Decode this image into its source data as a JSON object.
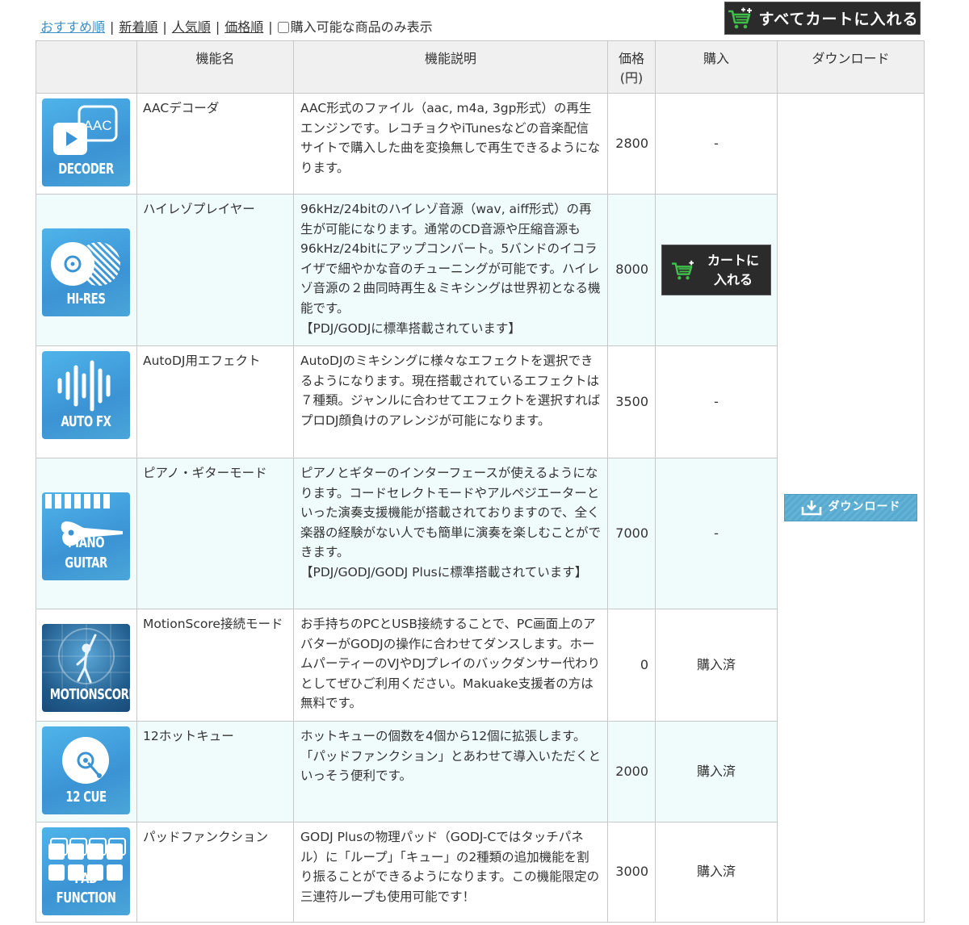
{
  "sort": {
    "recommended": "おすすめ順",
    "newest": "新着順",
    "popular": "人気順",
    "price": "価格順",
    "sep": "|",
    "purchasable_only": "購入可能な商品のみ表示",
    "purchasable_checked": false
  },
  "add_all_to_cart": "すべてカートに入れる",
  "columns": {
    "icon": "",
    "name": "機能名",
    "description": "機能説明",
    "price": "価格(円)",
    "buy": "購入",
    "download": "ダウンロード"
  },
  "rows": [
    {
      "icon_label": "DECODER",
      "name": "AACデコーダ",
      "description": "AAC形式のファイル（aac, m4a, 3gp形式）の再生エンジンです。レコチョクやiTunesなどの音楽配信サイトで購入した曲を変換無しで再生できるようになります。",
      "price": "2800",
      "buy": "-"
    },
    {
      "icon_label": "HI-RES",
      "name": "ハイレゾプレイヤー",
      "description": "96kHz/24bitのハイレゾ音源（wav, aiff形式）の再生が可能になります。通常のCD音源や圧縮音源も96kHz/24bitにアップコンバート。5バンドのイコライザで細やかな音のチューニングが可能です。ハイレゾ音源の２曲同時再生＆ミキシングは世界初となる機能です。",
      "note": "【PDJ/GODJに標準搭載されています】",
      "price": "8000",
      "buy": "",
      "cart_button": "カートに入れる"
    },
    {
      "icon_label": "AUTO FX",
      "name": "AutoDJ用エフェクト",
      "description": "AutoDJのミキシングに様々なエフェクトを選択できるようになります。現在搭載されているエフェクトは７種類。ジャンルに合わせてエフェクトを選択すればプロDJ顔負けのアレンジが可能になります。",
      "price": "3500",
      "buy": "-"
    },
    {
      "icon_label": "PIANO GUITAR",
      "name": "ピアノ・ギターモード",
      "description": "ピアノとギターのインターフェースが使えるようになります。コードセレクトモードやアルペジエーターといった演奏支援機能が搭載されておりますので、全く楽器の経験がない人でも簡単に演奏を楽しむことができます。",
      "note": "【PDJ/GODJ/GODJ Plusに標準搭載されています】",
      "price": "7000",
      "buy": "-"
    },
    {
      "icon_label": "MOTIONSCORE",
      "name": "MotionScore接続モード",
      "description": "お手持ちのPCとUSB接続することで、PC画面上のアバターがGODJの操作に合わせてダンスします。ホームパーティーのVJやDJプレイのバックダンサー代わりとしてぜひご利用ください。Makuake支援者の方は無料です。",
      "price": "0",
      "buy": "購入済"
    },
    {
      "icon_label": "12 CUE",
      "name": "12ホットキュー",
      "description": "ホットキューの個数を4個から12個に拡張します。「パッドファンクション」とあわせて導入いただくといっそう便利です。",
      "price": "2000",
      "buy": "購入済"
    },
    {
      "icon_label": "PAD FUNCTION",
      "name": "パッドファンクション",
      "description": "GODJ Plusの物理パッド（GODJ-Cではタッチパネル）に「ループ」「キュー」の2種類の追加機能を割り振ることができるようになります。この機能限定の三連符ループも使用可能です！",
      "price": "3000",
      "buy": "購入済"
    }
  ],
  "download_button": "ダウンロード",
  "colors": {
    "icon_blue": "#3b93d4",
    "cart_dark": "#2b2b2b",
    "cart_green": "#3fbf4a",
    "row_alt": "#f0fbfc",
    "download_blue": "#5aaed3",
    "link_active": "#3a8fc9"
  },
  "icons": {
    "cart": "shopping-cart-plus-icon",
    "download": "download-tray-icon"
  }
}
